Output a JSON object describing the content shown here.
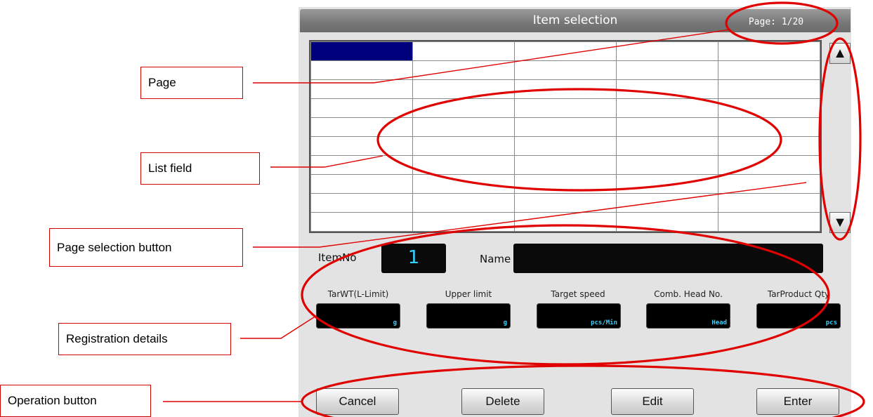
{
  "screen": {
    "title": "Item selection",
    "page_indicator": "Page: 1/20",
    "list": {
      "rows": 10,
      "columns": 5,
      "selected_cell": [
        0,
        0
      ]
    },
    "scroll_up_symbol": "▲",
    "scroll_down_symbol": "▼",
    "item_no": {
      "label": "ItemNo",
      "value": "1"
    },
    "name": {
      "label": "Name",
      "value": ""
    },
    "details": [
      {
        "label": "TarWT(L-Limit)",
        "unit": "g"
      },
      {
        "label": "Upper limit",
        "unit": "g"
      },
      {
        "label": "Target speed",
        "unit": "pcs/Min"
      },
      {
        "label": "Comb. Head No.",
        "unit": "Head"
      },
      {
        "label": "TarProduct Qty",
        "unit": "pcs"
      }
    ],
    "buttons": {
      "cancel": "Cancel",
      "delete": "Delete",
      "edit": "Edit",
      "enter": "Enter"
    }
  },
  "callouts": {
    "page": "Page",
    "list_field": "List field",
    "page_selection_button": "Page selection button",
    "registration_details": "Registration details",
    "operation_button": "Operation button"
  },
  "colors": {
    "annotation_red": "#e00000",
    "selected_cell": "#00007f",
    "value_cyan": "#36d0ff"
  }
}
